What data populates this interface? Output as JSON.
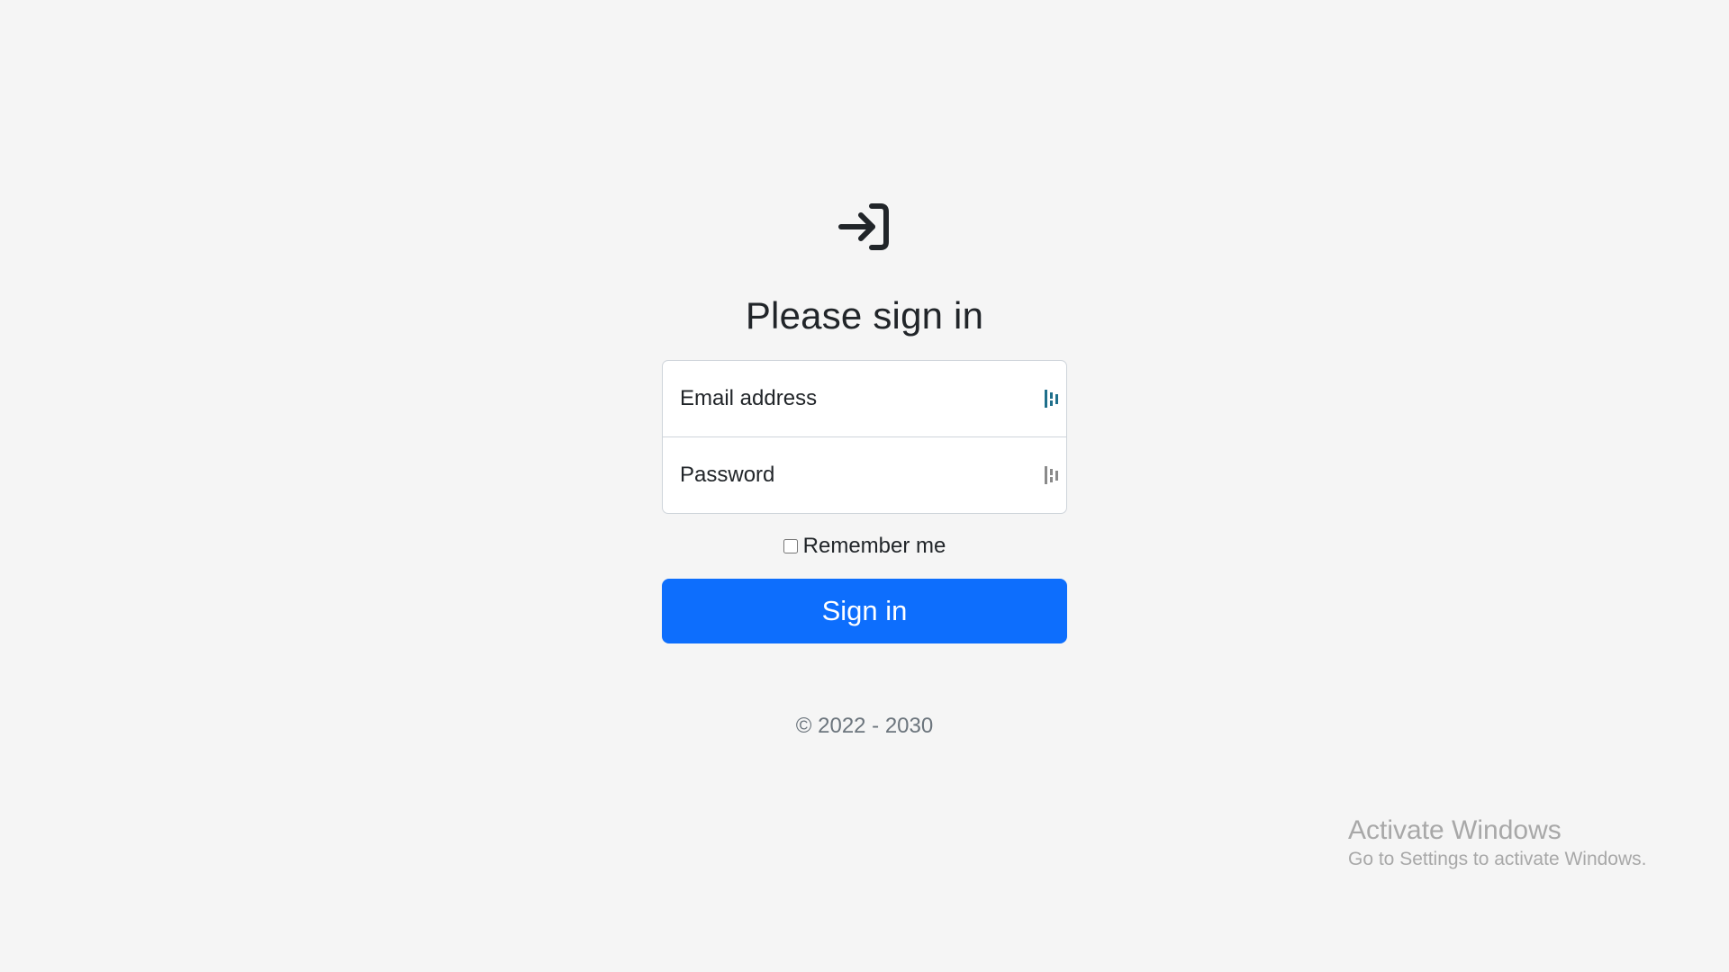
{
  "signin": {
    "logo_icon": "box-arrow-in-right-icon",
    "heading": "Please sign in",
    "email": {
      "placeholder": "Email address",
      "value": "",
      "autofill_icon": "password-manager-fill-icon",
      "autofill_icon_color": "#1f6f8b"
    },
    "password": {
      "placeholder": "Password",
      "value": "",
      "autofill_icon": "password-manager-fill-icon",
      "autofill_icon_color": "#8a8a8a"
    },
    "remember_label": "Remember me",
    "remember_checked": false,
    "submit_label": "Sign in",
    "copyright": "© 2022 - 2030"
  },
  "watermark": {
    "title": "Activate Windows",
    "subtitle": "Go to Settings to activate Windows."
  },
  "colors": {
    "background": "#f5f5f5",
    "primary": "#0d6efd",
    "text": "#212529",
    "muted": "#6c757d"
  }
}
